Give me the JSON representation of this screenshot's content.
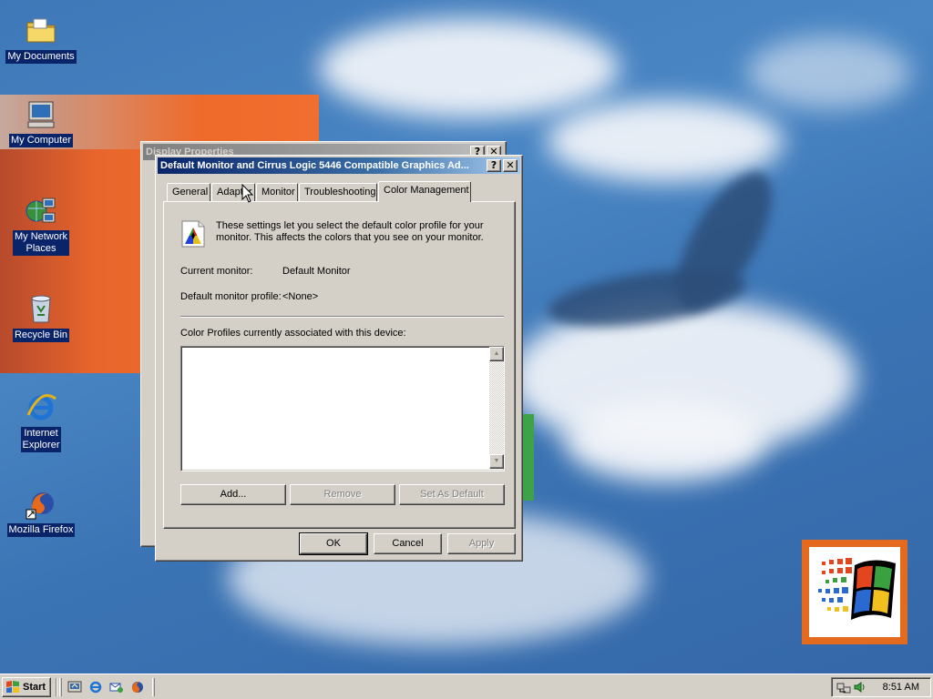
{
  "desktop": {
    "icons": [
      {
        "label": "My Documents",
        "icon": "folder-documents-icon"
      },
      {
        "label": "My Computer",
        "icon": "computer-icon"
      },
      {
        "label": "My Network",
        "label2": "Places",
        "icon": "network-places-icon"
      },
      {
        "label": "Recycle Bin",
        "icon": "recycle-bin-icon"
      },
      {
        "label": "Internet",
        "label2": "Explorer",
        "icon": "internet-explorer-icon"
      },
      {
        "label": "Mozilla Firefox",
        "icon": "firefox-icon"
      }
    ]
  },
  "display_properties": {
    "title": "Display Properties"
  },
  "dialog": {
    "title": "Default Monitor and Cirrus Logic 5446 Compatible Graphics Ad...",
    "help_button": "?",
    "close_button": "✕",
    "tabs": [
      "General",
      "Adapter",
      "Monitor",
      "Troubleshooting",
      "Color Management"
    ],
    "selected_tab": "Color Management",
    "description": "These settings let you select the default color profile for your monitor. This affects the colors that you see on your monitor.",
    "current_monitor_label": "Current monitor:",
    "current_monitor_value": "Default Monitor",
    "default_profile_label": "Default monitor profile:",
    "default_profile_value": "<None>",
    "profiles_list_label": "Color Profiles currently associated with this device:",
    "profiles": [],
    "add_button": "Add...",
    "remove_button": "Remove",
    "set_default_button": "Set As Default",
    "ok_button": "OK",
    "cancel_button": "Cancel",
    "apply_button": "Apply"
  },
  "taskbar": {
    "start_label": "Start",
    "quick_launch": [
      "show-desktop-icon",
      "internet-explorer-icon",
      "outlook-express-icon",
      "firefox-icon"
    ],
    "tray_icons": [
      "network-icon",
      "volume-icon"
    ],
    "clock": "8:51 AM"
  },
  "colors": {
    "desktop_blue": "#3f78b8",
    "active_title": "#0a246a",
    "inactive_title": "#808080",
    "face": "#d4d0c8"
  }
}
